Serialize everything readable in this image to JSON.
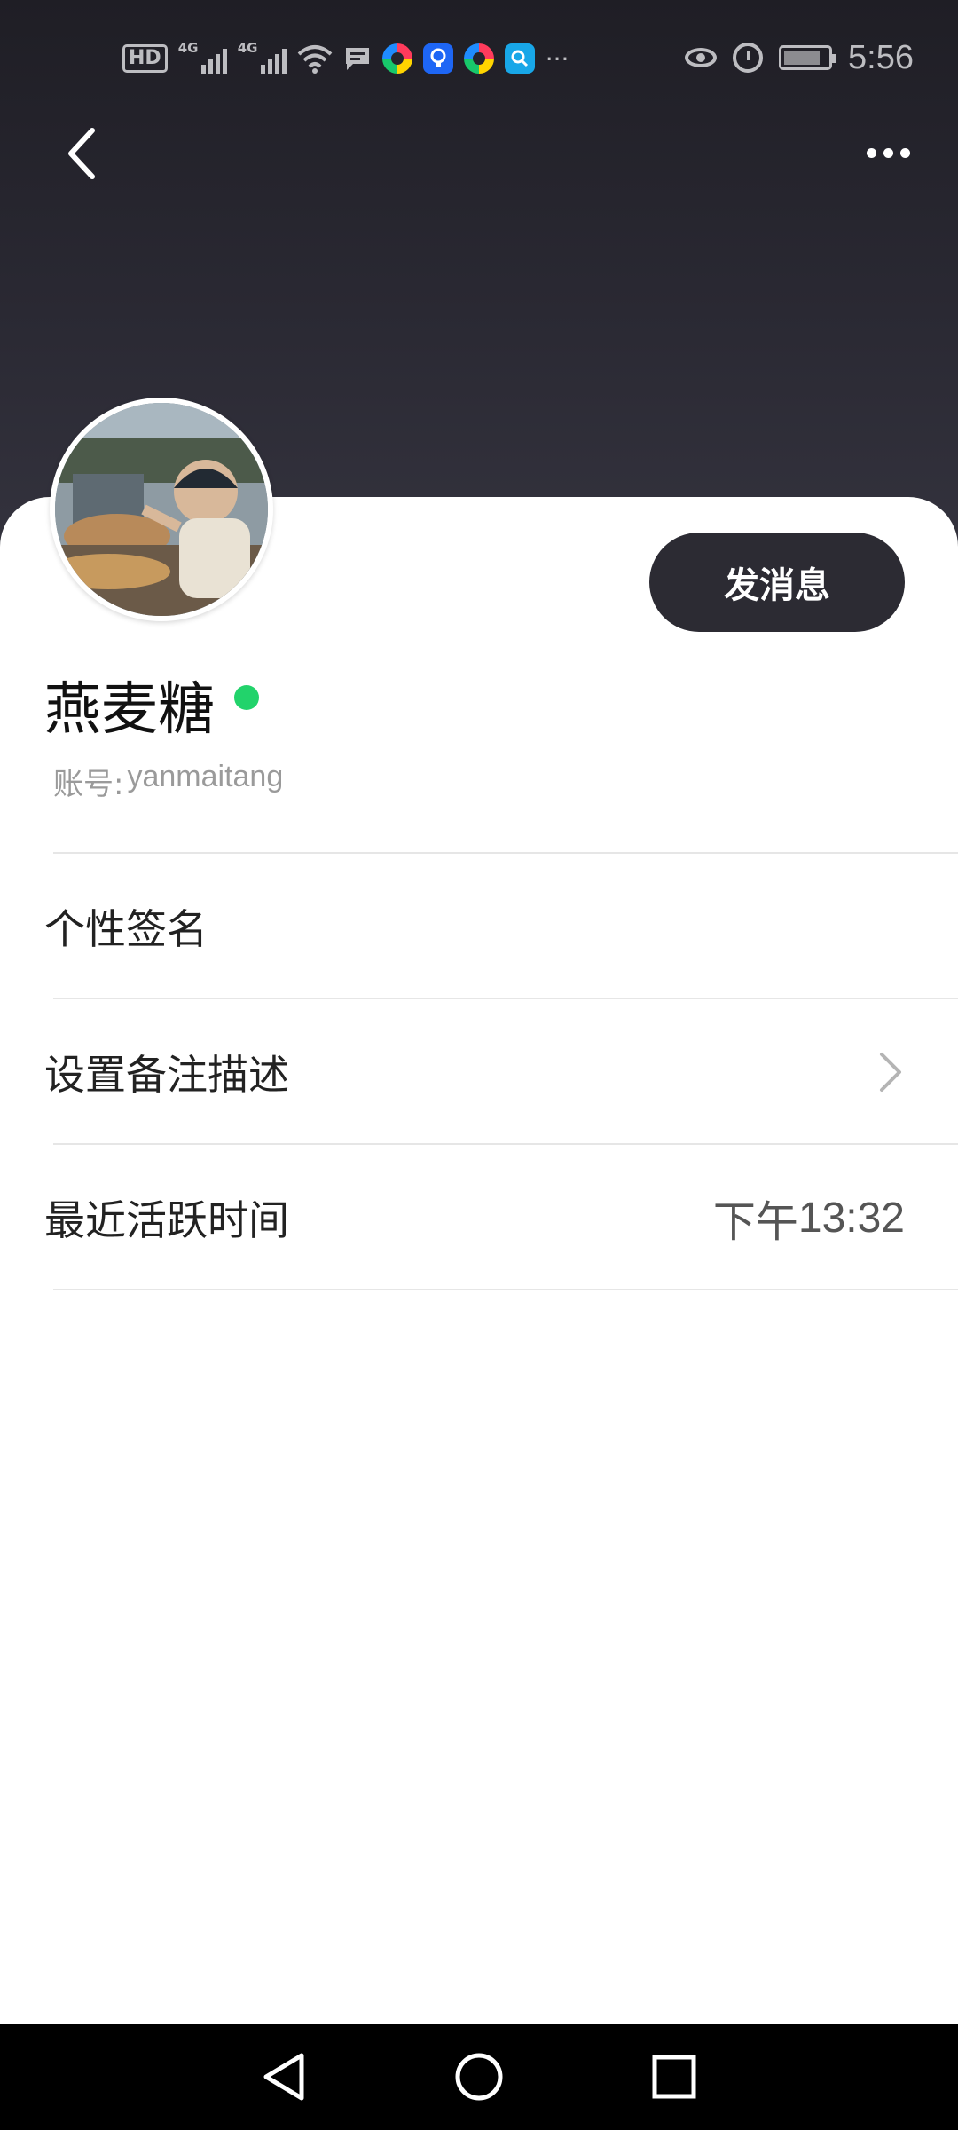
{
  "status_bar": {
    "time": "5:56",
    "hd_label": "HD",
    "network_labels": [
      "4G",
      "4G"
    ],
    "overflow": "···",
    "icons": [
      "hd-icon",
      "signal-icon",
      "signal-icon",
      "wifi-icon",
      "message-icon",
      "app-ring-icon",
      "app-bulb-icon",
      "app-ring-icon",
      "app-search-icon",
      "eye-icon",
      "alarm-icon",
      "battery-icon"
    ]
  },
  "nav": {
    "back_icon": "chevron-left-icon",
    "more_icon": "more-dots-icon"
  },
  "profile": {
    "name": "燕麦糖",
    "online": true,
    "account_prefix": "账号:",
    "account_id": "yanmaitang",
    "message_button": "发消息"
  },
  "rows": [
    {
      "label": "个性签名",
      "value": ""
    },
    {
      "label": "设置备注描述",
      "value": "",
      "has_chevron": true
    },
    {
      "label": "最近活跃时间",
      "value_prefix": "下午",
      "value": "13:32"
    }
  ],
  "colors": {
    "header_bg": "#2a2933",
    "button_bg": "#2c2b33",
    "online": "#22d36b",
    "divider": "#e6e6e6"
  },
  "system_nav": [
    "back-triangle-icon",
    "home-circle-icon",
    "recents-square-icon"
  ]
}
